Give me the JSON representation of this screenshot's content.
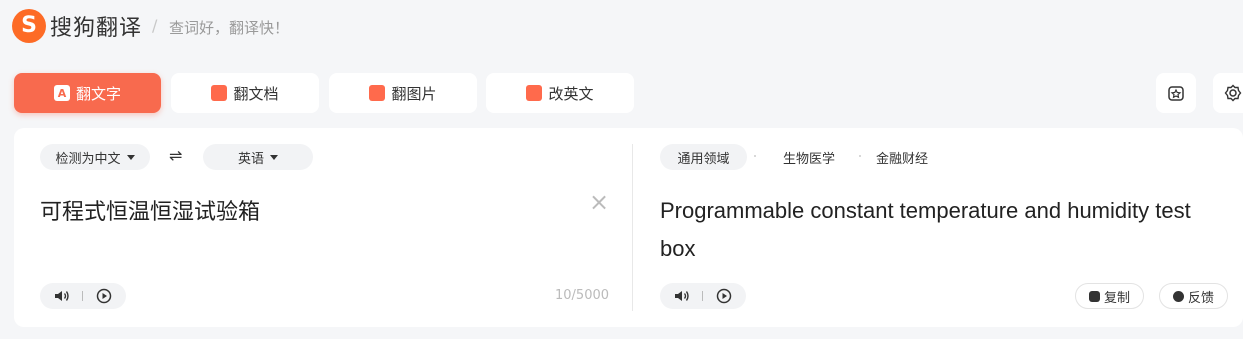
{
  "header": {
    "logo_letter": "S",
    "logo_text": "搜狗翻译",
    "separator": "/",
    "slogan": "查词好，翻译快！"
  },
  "tabs": [
    {
      "label": "翻文字",
      "icon": "text-translate-icon",
      "active": true
    },
    {
      "label": "翻文档",
      "icon": "document-icon"
    },
    {
      "label": "翻图片",
      "icon": "image-icon"
    },
    {
      "label": "改英文",
      "icon": "edit-english-icon"
    }
  ],
  "side_buttons": [
    {
      "icon": "favorites-star-icon"
    },
    {
      "icon": "settings-icon"
    }
  ],
  "source": {
    "lang_label": "检测为中文",
    "swap_icon": "⇌",
    "target_lang_label": "英语",
    "text": "可程式恒温恒湿试验箱",
    "clear_icon": "×",
    "counter": "10/5000"
  },
  "target": {
    "domains": [
      {
        "label": "通用领域",
        "active": true
      },
      {
        "label": "生物医学"
      },
      {
        "label": "金融财经"
      }
    ],
    "text": "Programmable constant temperature and humidity test box",
    "copy_label": "复制",
    "feedback_label": "反馈"
  },
  "colors": {
    "accent": "#f86a4e",
    "logo": "#fd6b26",
    "background": "#f5f6f8"
  }
}
